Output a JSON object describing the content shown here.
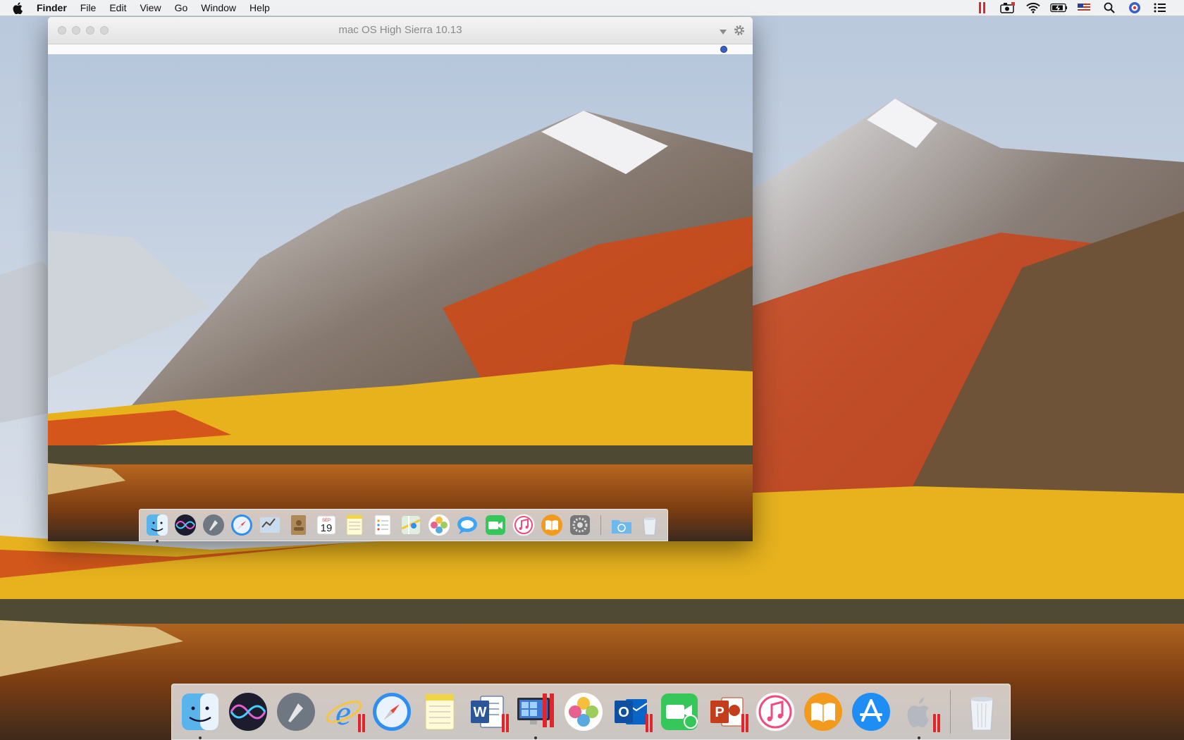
{
  "menubar": {
    "app_name": "Finder",
    "menus": [
      "File",
      "Edit",
      "View",
      "Go",
      "Window",
      "Help"
    ],
    "status_icons": [
      "parallels-icon",
      "camera-icon",
      "wifi-icon",
      "battery-icon",
      "us-flag-icon",
      "spotlight-icon",
      "user-icon",
      "notification-center-icon"
    ]
  },
  "vm_window": {
    "title": "mac OS High Sierra 10.13"
  },
  "vm_dock": {
    "items": [
      "finder",
      "siri",
      "launchpad",
      "safari",
      "mail",
      "contacts",
      "calendar",
      "notes",
      "reminders",
      "maps",
      "photos",
      "messages",
      "facetime",
      "itunes",
      "ibooks",
      "system-preferences",
      "downloads",
      "trash"
    ],
    "calendar": {
      "month": "SEP",
      "day": "19"
    }
  },
  "host_dock": {
    "items": [
      "finder",
      "siri",
      "launchpad",
      "internet-explorer",
      "safari",
      "notes",
      "word",
      "parallels-desktop",
      "photos",
      "outlook",
      "facetime",
      "powerpoint",
      "itunes",
      "ibooks",
      "app-store",
      "apple-boot-camp",
      "trash"
    ],
    "letters": {
      "word": "W",
      "outlook": "O",
      "powerpoint": "P"
    }
  }
}
